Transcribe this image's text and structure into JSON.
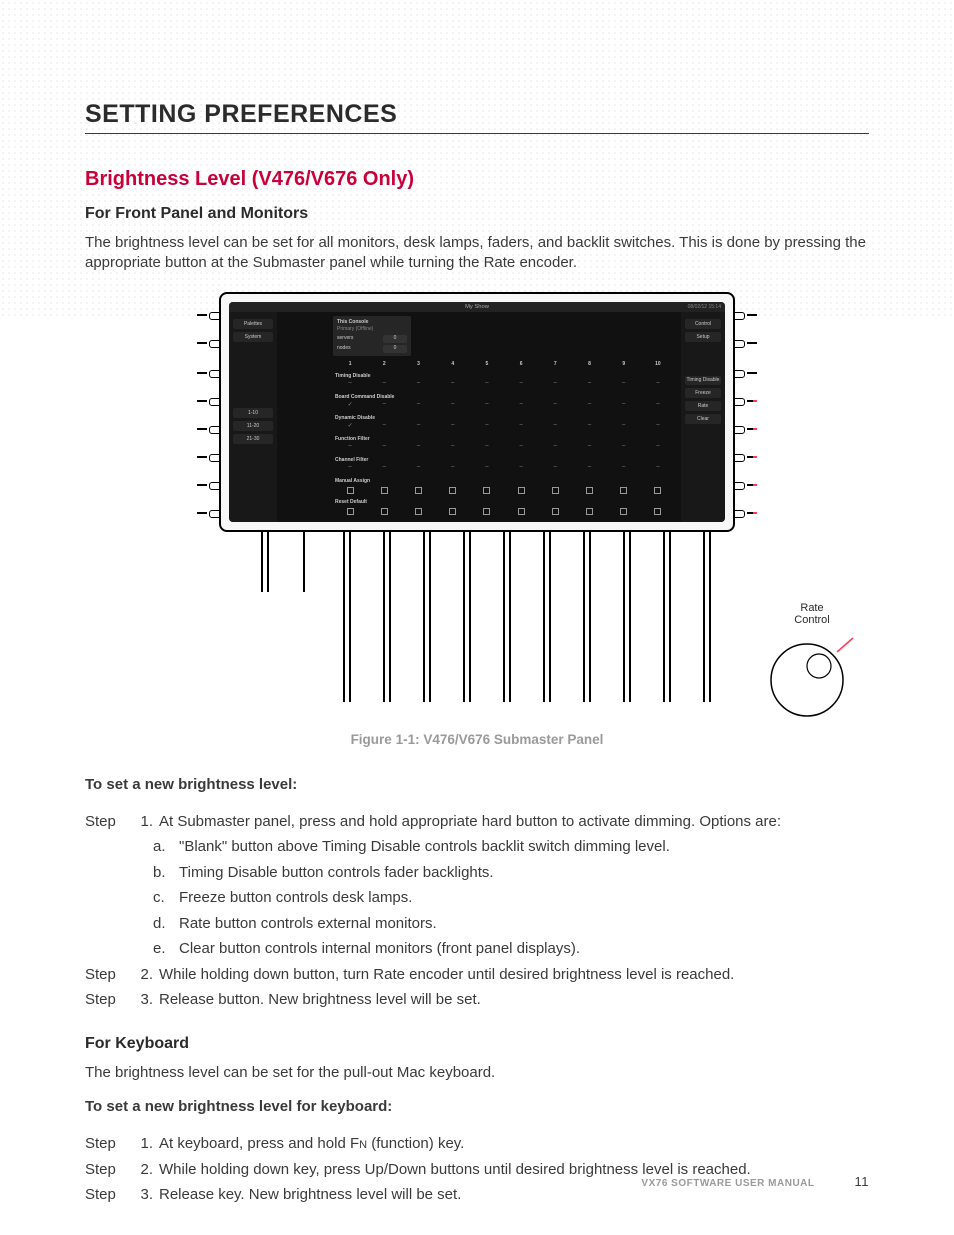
{
  "heading": "SETTING PREFERENCES",
  "section": {
    "title": "Brightness Level (V476/V676 Only)",
    "sub1": "For Front Panel and Monitors",
    "para1": "The brightness level can be set for all monitors, desk lamps, faders, and backlit switches. This is done by pressing the appropriate button at the Submaster panel while turning the Rate encoder.",
    "figure_caption": "Figure 1-1:  V476/V676 Submaster Panel",
    "procedure1_title": "To set a new brightness level:",
    "steps1": [
      "At Submaster panel, press and hold appropriate hard button to activate dimming. Options are:",
      "While holding down button, turn Rate encoder until desired brightness level is reached.",
      "Release button. New brightness level will be set."
    ],
    "substeps1": [
      "\"Blank\" button above Timing Disable controls backlit switch dimming level.",
      "Timing Disable button controls fader backlights.",
      "Freeze button controls desk lamps.",
      "Rate button controls external monitors.",
      "Clear button controls internal monitors (front panel displays)."
    ],
    "sub2": "For Keyboard",
    "para2": "The brightness level can be set for the pull-out Mac keyboard.",
    "procedure2_title": "To set a new brightness level for keyboard:",
    "steps2": [
      "At keyboard, press and hold Fn (function) key.",
      "While holding down key, press Up/Down buttons until desired brightness level is reached.",
      "Release key. New brightness level will be set."
    ]
  },
  "panel": {
    "topbar_center": "My Show",
    "topbar_right": "08/02/12  15:14",
    "left_buttons": [
      "Palettes",
      "System"
    ],
    "left_ranges": [
      "1-10",
      "11-20",
      "21-30"
    ],
    "right_buttons": [
      "Control",
      "Setup",
      "",
      "Timing Disable",
      "Freeze",
      "Rate",
      "Clear"
    ],
    "mid_box": {
      "title": "This Console",
      "sub": "Primary (Offline)",
      "rows": [
        "servers",
        "nodes"
      ],
      "zero": "0"
    },
    "columns": [
      "1",
      "2",
      "3",
      "4",
      "5",
      "6",
      "7",
      "8",
      "9",
      "10"
    ],
    "row_labels": [
      "Timing Disable",
      "Board Command Disable",
      "Dynamic Disable",
      "Function Filter",
      "Channel Filter",
      "Manual Assign",
      "Reset Default"
    ],
    "rate_label": "Rate\nControl"
  },
  "labels": {
    "step": "Step"
  },
  "footer": {
    "manual": "VX76 SOFTWARE USER MANUAL",
    "page": "11"
  }
}
